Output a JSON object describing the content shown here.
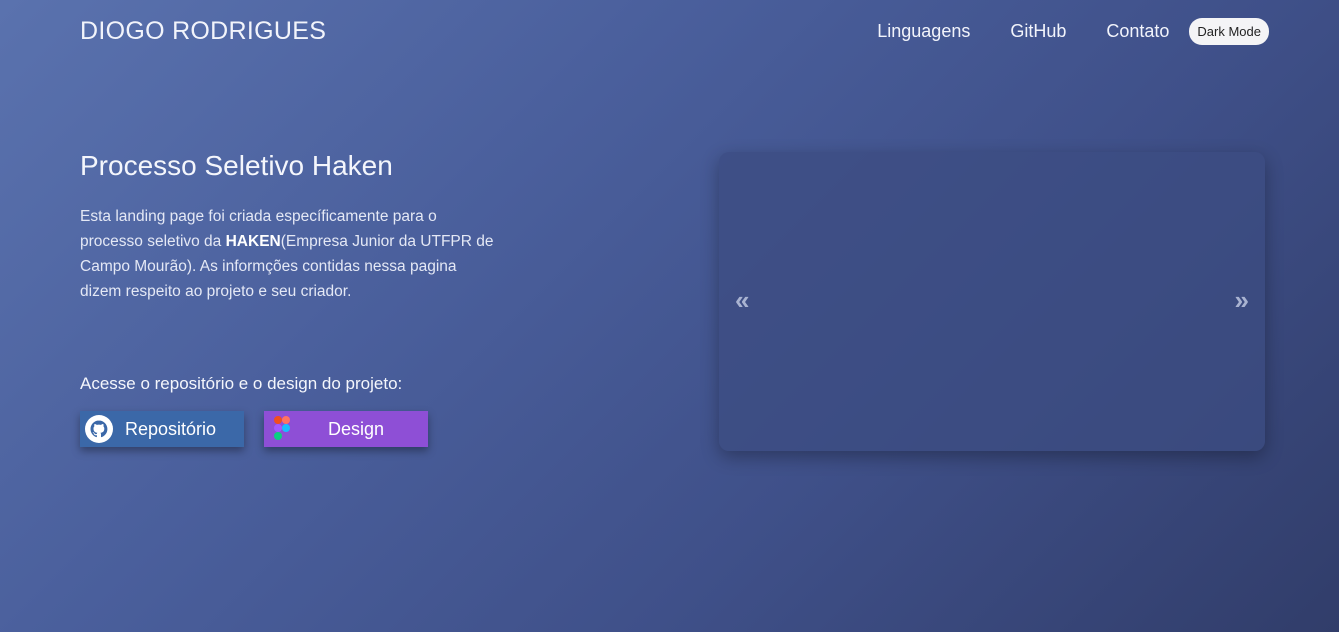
{
  "header": {
    "logo": "DIOGO RODRIGUES",
    "nav": [
      "Linguagens",
      "GitHub",
      "Contato"
    ],
    "dark_mode_label": "Dark Mode"
  },
  "hero": {
    "title": "Processo Seletivo Haken",
    "desc_before": "Esta landing page foi criada específicamente para o processo seletivo da ",
    "desc_bold": "HAKEN",
    "desc_after": "(Empresa Junior da UTFPR de Campo Mourão). As informções contidas nessa pagina dizem respeito ao projeto e seu criador.",
    "repo_label": "Acesse o repositório e o design do projeto:",
    "repo_button": "Repositório",
    "design_button": "Design"
  },
  "carousel": {
    "prev_symbol": "«",
    "next_symbol": "»"
  },
  "icons": {
    "repo": "github-icon",
    "design": "figma-icon"
  },
  "colors": {
    "repo_button": "#3b68a8",
    "design_button": "#8e4fd6"
  }
}
